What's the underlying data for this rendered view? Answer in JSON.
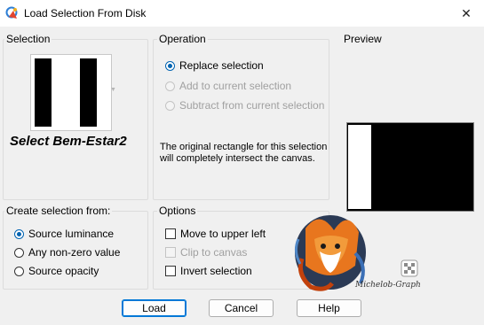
{
  "window": {
    "title": "Load Selection From Disk",
    "close_glyph": "✕"
  },
  "selection": {
    "label": "Selection",
    "name": "Select Bem-Estar2",
    "dropdown_glyph": "▼"
  },
  "operation": {
    "label": "Operation",
    "options": [
      {
        "label": "Replace selection",
        "checked": true,
        "disabled": false
      },
      {
        "label": "Add to current selection",
        "checked": false,
        "disabled": true
      },
      {
        "label": "Subtract from current selection",
        "checked": false,
        "disabled": true
      }
    ],
    "description": "The original rectangle for this selection will completely intersect the canvas."
  },
  "preview": {
    "label": "Preview"
  },
  "create_from": {
    "label": "Create selection from:",
    "options": [
      {
        "label": "Source luminance",
        "checked": true
      },
      {
        "label": "Any non-zero value",
        "checked": false
      },
      {
        "label": "Source opacity",
        "checked": false
      }
    ]
  },
  "options": {
    "label": "Options",
    "items": [
      {
        "label": "Move to upper left",
        "checked": false,
        "disabled": false
      },
      {
        "label": "Clip to canvas",
        "checked": false,
        "disabled": true
      },
      {
        "label": "Invert selection",
        "checked": false,
        "disabled": false
      }
    ]
  },
  "watermark": {
    "text": "Michelob-Graph"
  },
  "buttons": {
    "load": "Load",
    "cancel": "Cancel",
    "help": "Help"
  },
  "colors": {
    "accent": "#0063b1",
    "default_button_border": "#0078d7",
    "disabled_text": "#a0a0a0"
  }
}
